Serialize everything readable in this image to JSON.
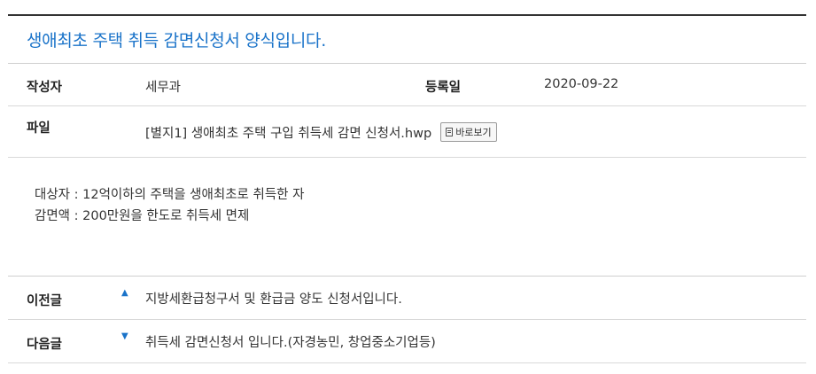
{
  "post": {
    "title": "생애최초 주택 취득 감면신청서 양식입니다.",
    "author_label": "작성자",
    "author": "세무과",
    "date_label": "등록일",
    "date": "2020-09-22",
    "file_label": "파일",
    "file_name": "[별지1] 생애최초 주택 구입 취득세 감면 신청서.hwp",
    "view_button": "바로보기",
    "content_lines": [
      "대상자 : 12억이하의 주택을 생애최초로 취득한 자",
      "감면액 : 200만원을 한도로 취득세 면제"
    ]
  },
  "navigation": {
    "prev_label": "이전글",
    "prev_title": "지방세환급청구서 및 환급금 양도 신청서입니다.",
    "next_label": "다음글",
    "next_title": "취득세 감면신청서 입니다.(자경농민, 창업중소기업등)"
  },
  "icons": {
    "prev_arrow": "caret-up-icon",
    "next_arrow": "caret-down-icon",
    "view_icon": "document-icon"
  },
  "colors": {
    "title": "#1a73c9",
    "arrow": "#1a73c9",
    "top_border": "#333333"
  }
}
